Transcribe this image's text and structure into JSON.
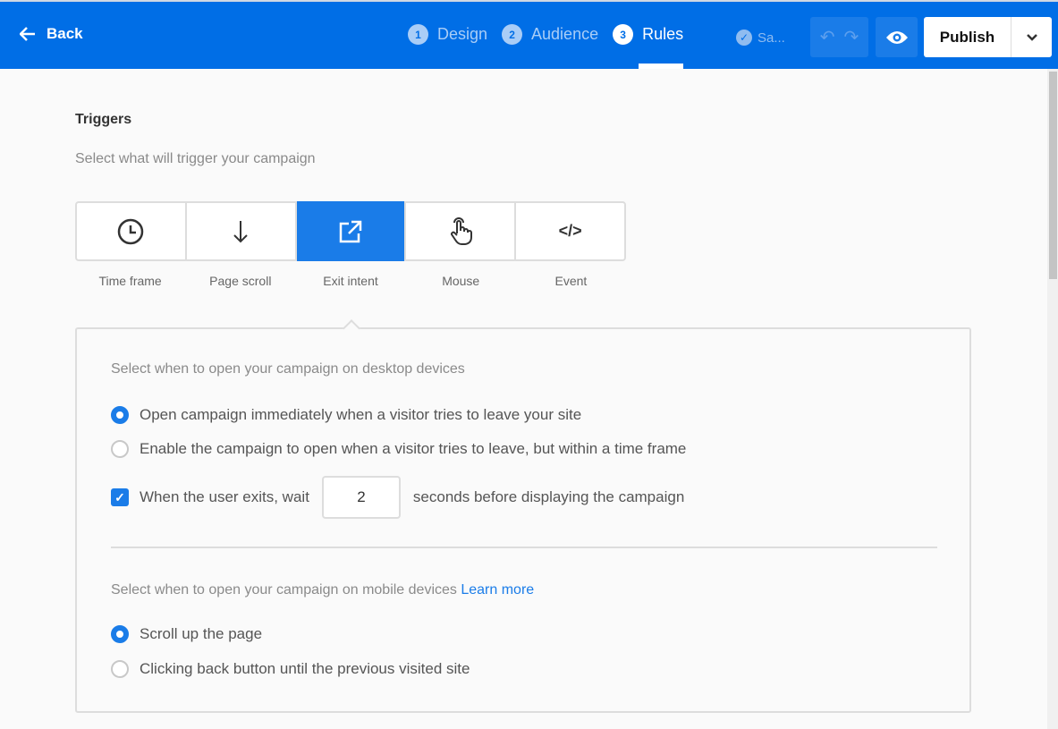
{
  "header": {
    "back_label": "Back",
    "steps": [
      {
        "num": "1",
        "label": "Design"
      },
      {
        "num": "2",
        "label": "Audience"
      },
      {
        "num": "3",
        "label": "Rules"
      }
    ],
    "saved_label": "Sa...",
    "publish_label": "Publish"
  },
  "triggers": {
    "title": "Triggers",
    "subtitle": "Select what will trigger your campaign",
    "tiles": [
      {
        "label": "Time frame",
        "icon": "clock-icon"
      },
      {
        "label": "Page scroll",
        "icon": "arrow-down-icon"
      },
      {
        "label": "Exit intent",
        "icon": "external-link-icon"
      },
      {
        "label": "Mouse",
        "icon": "hand-pointer-icon"
      },
      {
        "label": "Event",
        "icon": "code-icon"
      }
    ],
    "selected": "Exit intent",
    "event_icon_text": "</>"
  },
  "desktop": {
    "heading": "Select when to open your campaign on desktop devices",
    "options": [
      "Open campaign immediately when a visitor tries to leave your site",
      "Enable the campaign to open when a visitor tries to leave, but within a time frame"
    ],
    "wait_prefix": "When the user exits, wait",
    "wait_value": "2",
    "wait_suffix": "seconds before displaying the campaign"
  },
  "mobile": {
    "heading": "Select when to open your campaign on mobile devices",
    "learn_more": "Learn more",
    "options": [
      "Scroll up the page",
      "Clicking back button until the previous visited site"
    ]
  },
  "colors": {
    "brand": "#006ee6",
    "accent": "#1a7ce8"
  }
}
